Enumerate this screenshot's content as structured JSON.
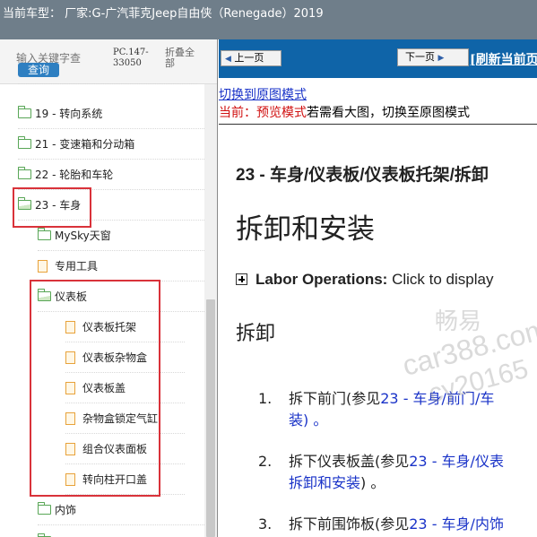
{
  "titlebar": {
    "text": "当前车型：  厂家:G-广汽菲克Jeep自由侠（Renegade）2019"
  },
  "sidebar": {
    "search_placeholder": "输入关键字查",
    "search_button": "查询",
    "code": "PC.147-33050",
    "collapse": "折叠全部",
    "items": [
      {
        "label": "19 - 转向系统"
      },
      {
        "label": "21 - 变速箱和分动箱"
      },
      {
        "label": "22 - 轮胎和车轮"
      },
      {
        "label": "23 - 车身"
      },
      {
        "label": "MySky天窗"
      },
      {
        "label": "专用工具"
      },
      {
        "label": "仪表板"
      },
      {
        "label": "仪表板托架"
      },
      {
        "label": "仪表板杂物盒"
      },
      {
        "label": "仪表板盖"
      },
      {
        "label": "杂物盒锁定气缸"
      },
      {
        "label": "组合仪表面板"
      },
      {
        "label": "转向柱开口盖"
      },
      {
        "label": "内饰"
      }
    ]
  },
  "content": {
    "prev_button": "上一页",
    "next_button": "下一页",
    "refresh_link": "[刷新当前页",
    "switch_link": "切换到原图模式",
    "current_prefix": "当前：",
    "current_mode": "预览模式",
    "current_suffix": "若需看大图，切换至原图模式",
    "heading": "23 - 车身/仪表板/仪表板托架/拆卸",
    "title": "拆卸和安装",
    "labor_bold": "Labor Operations:",
    "labor_rest": " Click to display",
    "section": "拆卸",
    "steps": [
      {
        "num": "1.",
        "line1_text": "拆下前门(参见",
        "line1_link": "23 - 车身/前门/车",
        "line2": "装) 。"
      },
      {
        "num": "2.",
        "line1_text": "拆下仪表板盖(参见",
        "line1_link": "23 - 车身/仪表",
        "line2_link": "拆卸和安装",
        "line2_text": ") 。"
      },
      {
        "num": "3.",
        "line1_text": "拆下前围饰板(参见",
        "line1_link": "23 - 车身/内饰"
      }
    ]
  },
  "watermark": {
    "line1": "畅易",
    "line2": "car388.com",
    "line3": "cy20165"
  }
}
